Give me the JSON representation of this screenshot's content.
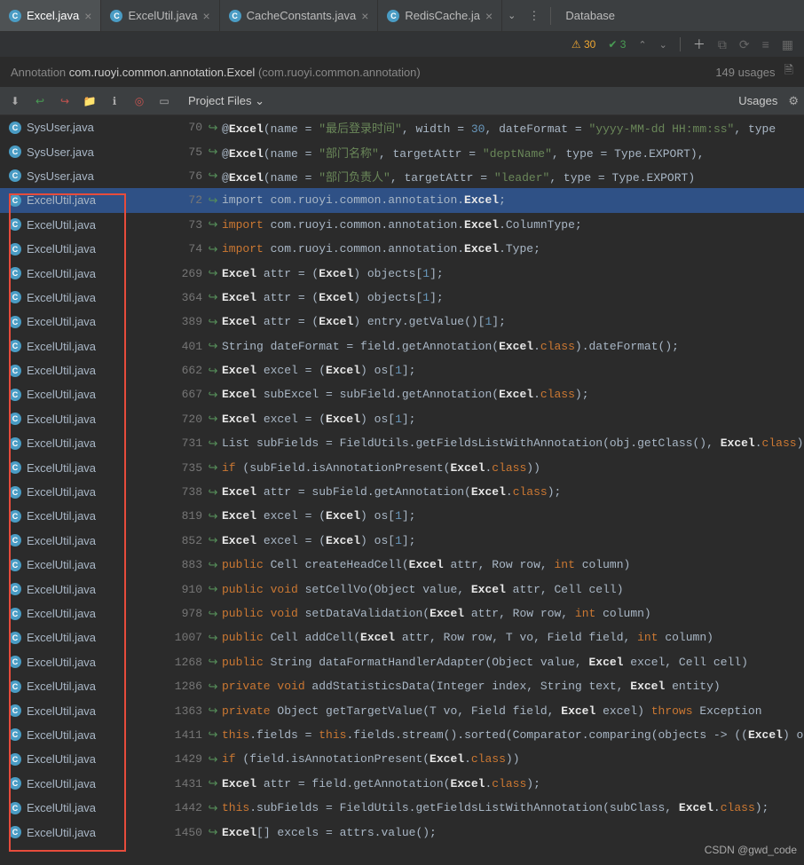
{
  "tabs": [
    {
      "label": "Excel.java",
      "active": true
    },
    {
      "label": "ExcelUtil.java",
      "active": false
    },
    {
      "label": "CacheConstants.java",
      "active": false
    },
    {
      "label": "RedisCache.ja",
      "active": false
    }
  ],
  "database_label": "Database",
  "status": {
    "warnings": "30",
    "oks": "3"
  },
  "breadcrumb": {
    "prefix": "Annotation ",
    "pkg": "com.ruoyi.common.annotation.Excel",
    "suffix": " (com.ruoyi.common.annotation)",
    "usages": "149 usages"
  },
  "toolbar": {
    "project_files": "Project Files",
    "usages": "Usages"
  },
  "rows": [
    {
      "file": "SysUser.java",
      "line": "70",
      "tokens": [
        {
          "t": "@",
          "c": ""
        },
        {
          "t": "Excel",
          "c": "bold"
        },
        {
          "t": "(name = ",
          "c": ""
        },
        {
          "t": "\"最后登录时间\"",
          "c": "str"
        },
        {
          "t": ", width = ",
          "c": ""
        },
        {
          "t": "30",
          "c": "num"
        },
        {
          "t": ", dateFormat = ",
          "c": ""
        },
        {
          "t": "\"yyyy-MM-dd HH:mm:ss\"",
          "c": "str"
        },
        {
          "t": ", type",
          "c": ""
        }
      ]
    },
    {
      "file": "SysUser.java",
      "line": "75",
      "tokens": [
        {
          "t": "@",
          "c": ""
        },
        {
          "t": "Excel",
          "c": "bold"
        },
        {
          "t": "(name = ",
          "c": ""
        },
        {
          "t": "\"部门名称\"",
          "c": "str"
        },
        {
          "t": ", targetAttr = ",
          "c": ""
        },
        {
          "t": "\"deptName\"",
          "c": "str"
        },
        {
          "t": ", type = Type.EXPORT),",
          "c": ""
        }
      ]
    },
    {
      "file": "SysUser.java",
      "line": "76",
      "tokens": [
        {
          "t": "@",
          "c": ""
        },
        {
          "t": "Excel",
          "c": "bold"
        },
        {
          "t": "(name = ",
          "c": ""
        },
        {
          "t": "\"部门负责人\"",
          "c": "str"
        },
        {
          "t": ", targetAttr = ",
          "c": ""
        },
        {
          "t": "\"leader\"",
          "c": "str"
        },
        {
          "t": ", type = Type.EXPORT)",
          "c": ""
        }
      ]
    },
    {
      "file": "ExcelUtil.java",
      "line": "72",
      "highlight": true,
      "tokens": [
        {
          "t": "import ",
          "c": ""
        },
        {
          "t": "com.ruoyi.common.annotation.",
          "c": ""
        },
        {
          "t": "Excel",
          "c": "bold"
        },
        {
          "t": ";",
          "c": ""
        }
      ]
    },
    {
      "file": "ExcelUtil.java",
      "line": "73",
      "tokens": [
        {
          "t": "import ",
          "c": "kw"
        },
        {
          "t": "com.ruoyi.common.annotation.",
          "c": ""
        },
        {
          "t": "Excel",
          "c": "bold"
        },
        {
          "t": ".ColumnType;",
          "c": ""
        }
      ]
    },
    {
      "file": "ExcelUtil.java",
      "line": "74",
      "tokens": [
        {
          "t": "import ",
          "c": "kw"
        },
        {
          "t": "com.ruoyi.common.annotation.",
          "c": ""
        },
        {
          "t": "Excel",
          "c": "bold"
        },
        {
          "t": ".Type;",
          "c": ""
        }
      ]
    },
    {
      "file": "ExcelUtil.java",
      "line": "269",
      "tokens": [
        {
          "t": "Excel",
          "c": "bold"
        },
        {
          "t": " attr = (",
          "c": ""
        },
        {
          "t": "Excel",
          "c": "bold"
        },
        {
          "t": ") objects[",
          "c": ""
        },
        {
          "t": "1",
          "c": "num"
        },
        {
          "t": "];",
          "c": ""
        }
      ]
    },
    {
      "file": "ExcelUtil.java",
      "line": "364",
      "tokens": [
        {
          "t": "Excel",
          "c": "bold"
        },
        {
          "t": " attr = (",
          "c": ""
        },
        {
          "t": "Excel",
          "c": "bold"
        },
        {
          "t": ") objects[",
          "c": ""
        },
        {
          "t": "1",
          "c": "num"
        },
        {
          "t": "];",
          "c": ""
        }
      ]
    },
    {
      "file": "ExcelUtil.java",
      "line": "389",
      "tokens": [
        {
          "t": "Excel",
          "c": "bold"
        },
        {
          "t": " attr = (",
          "c": ""
        },
        {
          "t": "Excel",
          "c": "bold"
        },
        {
          "t": ") entry.getValue()[",
          "c": ""
        },
        {
          "t": "1",
          "c": "num"
        },
        {
          "t": "];",
          "c": ""
        }
      ]
    },
    {
      "file": "ExcelUtil.java",
      "line": "401",
      "tokens": [
        {
          "t": "String dateFormat = field.getAnnotation(",
          "c": ""
        },
        {
          "t": "Excel",
          "c": "bold"
        },
        {
          "t": ".",
          "c": ""
        },
        {
          "t": "class",
          "c": "kw"
        },
        {
          "t": ").dateFormat();",
          "c": ""
        }
      ]
    },
    {
      "file": "ExcelUtil.java",
      "line": "662",
      "tokens": [
        {
          "t": "Excel",
          "c": "bold"
        },
        {
          "t": " excel = (",
          "c": ""
        },
        {
          "t": "Excel",
          "c": "bold"
        },
        {
          "t": ") os[",
          "c": ""
        },
        {
          "t": "1",
          "c": "num"
        },
        {
          "t": "];",
          "c": ""
        }
      ]
    },
    {
      "file": "ExcelUtil.java",
      "line": "667",
      "tokens": [
        {
          "t": "Excel",
          "c": "bold"
        },
        {
          "t": " subExcel = subField.getAnnotation(",
          "c": ""
        },
        {
          "t": "Excel",
          "c": "bold"
        },
        {
          "t": ".",
          "c": ""
        },
        {
          "t": "class",
          "c": "kw"
        },
        {
          "t": ");",
          "c": ""
        }
      ]
    },
    {
      "file": "ExcelUtil.java",
      "line": "720",
      "tokens": [
        {
          "t": "Excel",
          "c": "bold"
        },
        {
          "t": " excel = (",
          "c": ""
        },
        {
          "t": "Excel",
          "c": "bold"
        },
        {
          "t": ") os[",
          "c": ""
        },
        {
          "t": "1",
          "c": "num"
        },
        {
          "t": "];",
          "c": ""
        }
      ]
    },
    {
      "file": "ExcelUtil.java",
      "line": "731",
      "tokens": [
        {
          "t": "List<Field> subFields = FieldUtils.getFieldsListWithAnnotation(obj.getClass(), ",
          "c": ""
        },
        {
          "t": "Excel",
          "c": "bold"
        },
        {
          "t": ".",
          "c": ""
        },
        {
          "t": "class",
          "c": "kw"
        },
        {
          "t": ")",
          "c": ""
        }
      ]
    },
    {
      "file": "ExcelUtil.java",
      "line": "735",
      "tokens": [
        {
          "t": "if ",
          "c": "kw"
        },
        {
          "t": "(subField.isAnnotationPresent(",
          "c": ""
        },
        {
          "t": "Excel",
          "c": "bold"
        },
        {
          "t": ".",
          "c": ""
        },
        {
          "t": "class",
          "c": "kw"
        },
        {
          "t": "))",
          "c": ""
        }
      ]
    },
    {
      "file": "ExcelUtil.java",
      "line": "738",
      "tokens": [
        {
          "t": "Excel",
          "c": "bold"
        },
        {
          "t": " attr = subField.getAnnotation(",
          "c": ""
        },
        {
          "t": "Excel",
          "c": "bold"
        },
        {
          "t": ".",
          "c": ""
        },
        {
          "t": "class",
          "c": "kw"
        },
        {
          "t": ");",
          "c": ""
        }
      ]
    },
    {
      "file": "ExcelUtil.java",
      "line": "819",
      "tokens": [
        {
          "t": "Excel",
          "c": "bold"
        },
        {
          "t": " excel = (",
          "c": ""
        },
        {
          "t": "Excel",
          "c": "bold"
        },
        {
          "t": ") os[",
          "c": ""
        },
        {
          "t": "1",
          "c": "num"
        },
        {
          "t": "];",
          "c": ""
        }
      ]
    },
    {
      "file": "ExcelUtil.java",
      "line": "852",
      "tokens": [
        {
          "t": "Excel",
          "c": "bold"
        },
        {
          "t": " excel = (",
          "c": ""
        },
        {
          "t": "Excel",
          "c": "bold"
        },
        {
          "t": ") os[",
          "c": ""
        },
        {
          "t": "1",
          "c": "num"
        },
        {
          "t": "];",
          "c": ""
        }
      ]
    },
    {
      "file": "ExcelUtil.java",
      "line": "883",
      "tokens": [
        {
          "t": "public ",
          "c": "kw"
        },
        {
          "t": "Cell createHeadCell(",
          "c": ""
        },
        {
          "t": "Excel",
          "c": "bold"
        },
        {
          "t": " attr, Row row, ",
          "c": ""
        },
        {
          "t": "int ",
          "c": "kw"
        },
        {
          "t": "column)",
          "c": ""
        }
      ]
    },
    {
      "file": "ExcelUtil.java",
      "line": "910",
      "tokens": [
        {
          "t": "public void ",
          "c": "kw"
        },
        {
          "t": "setCellVo(Object value, ",
          "c": ""
        },
        {
          "t": "Excel",
          "c": "bold"
        },
        {
          "t": " attr, Cell cell)",
          "c": ""
        }
      ]
    },
    {
      "file": "ExcelUtil.java",
      "line": "978",
      "tokens": [
        {
          "t": "public void ",
          "c": "kw"
        },
        {
          "t": "setDataValidation(",
          "c": ""
        },
        {
          "t": "Excel",
          "c": "bold"
        },
        {
          "t": " attr, Row row, ",
          "c": ""
        },
        {
          "t": "int ",
          "c": "kw"
        },
        {
          "t": "column)",
          "c": ""
        }
      ]
    },
    {
      "file": "ExcelUtil.java",
      "line": "1007",
      "tokens": [
        {
          "t": "public ",
          "c": "kw"
        },
        {
          "t": "Cell addCell(",
          "c": ""
        },
        {
          "t": "Excel",
          "c": "bold"
        },
        {
          "t": " attr, Row row, T vo, Field field, ",
          "c": ""
        },
        {
          "t": "int ",
          "c": "kw"
        },
        {
          "t": "column)",
          "c": ""
        }
      ]
    },
    {
      "file": "ExcelUtil.java",
      "line": "1268",
      "tokens": [
        {
          "t": "public ",
          "c": "kw"
        },
        {
          "t": "String dataFormatHandlerAdapter(Object value, ",
          "c": ""
        },
        {
          "t": "Excel",
          "c": "bold"
        },
        {
          "t": " excel, Cell cell)",
          "c": ""
        }
      ]
    },
    {
      "file": "ExcelUtil.java",
      "line": "1286",
      "tokens": [
        {
          "t": "private void ",
          "c": "kw"
        },
        {
          "t": "addStatisticsData(Integer index, String text, ",
          "c": ""
        },
        {
          "t": "Excel",
          "c": "bold"
        },
        {
          "t": " entity)",
          "c": ""
        }
      ]
    },
    {
      "file": "ExcelUtil.java",
      "line": "1363",
      "tokens": [
        {
          "t": "private ",
          "c": "kw"
        },
        {
          "t": "Object getTargetValue(T vo, Field field, ",
          "c": ""
        },
        {
          "t": "Excel",
          "c": "bold"
        },
        {
          "t": " excel) ",
          "c": ""
        },
        {
          "t": "throws ",
          "c": "kw"
        },
        {
          "t": "Exception",
          "c": ""
        }
      ]
    },
    {
      "file": "ExcelUtil.java",
      "line": "1411",
      "tokens": [
        {
          "t": "this",
          "c": "kw"
        },
        {
          "t": ".fields = ",
          "c": ""
        },
        {
          "t": "this",
          "c": "kw"
        },
        {
          "t": ".fields.stream().sorted(Comparator.comparing(objects -> ((",
          "c": ""
        },
        {
          "t": "Excel",
          "c": "bold"
        },
        {
          "t": ") objects",
          "c": ""
        }
      ]
    },
    {
      "file": "ExcelUtil.java",
      "line": "1429",
      "tokens": [
        {
          "t": "if ",
          "c": "kw"
        },
        {
          "t": "(field.isAnnotationPresent(",
          "c": ""
        },
        {
          "t": "Excel",
          "c": "bold"
        },
        {
          "t": ".",
          "c": ""
        },
        {
          "t": "class",
          "c": "kw"
        },
        {
          "t": "))",
          "c": ""
        }
      ]
    },
    {
      "file": "ExcelUtil.java",
      "line": "1431",
      "tokens": [
        {
          "t": "Excel",
          "c": "bold"
        },
        {
          "t": " attr = field.getAnnotation(",
          "c": ""
        },
        {
          "t": "Excel",
          "c": "bold"
        },
        {
          "t": ".",
          "c": ""
        },
        {
          "t": "class",
          "c": "kw"
        },
        {
          "t": ");",
          "c": ""
        }
      ]
    },
    {
      "file": "ExcelUtil.java",
      "line": "1442",
      "tokens": [
        {
          "t": "this",
          "c": "kw"
        },
        {
          "t": ".subFields = FieldUtils.getFieldsListWithAnnotation(subClass, ",
          "c": ""
        },
        {
          "t": "Excel",
          "c": "bold"
        },
        {
          "t": ".",
          "c": ""
        },
        {
          "t": "class",
          "c": "kw"
        },
        {
          "t": ");",
          "c": ""
        }
      ]
    },
    {
      "file": "ExcelUtil.java",
      "line": "1450",
      "tokens": [
        {
          "t": "Excel",
          "c": "bold"
        },
        {
          "t": "[] excels = attrs.value();",
          "c": ""
        }
      ]
    }
  ],
  "watermark": "CSDN @gwd_code"
}
